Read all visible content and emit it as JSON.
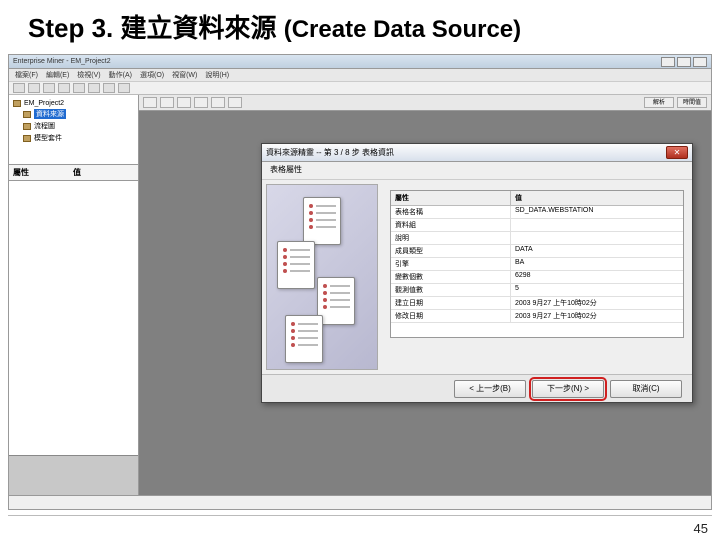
{
  "slide": {
    "step_prefix": "Step 3.",
    "title_cjk": "建立資料來源",
    "title_sub": "(Create Data Source)",
    "page_number": "45"
  },
  "app": {
    "title": "Enterprise Miner - EM_Project2",
    "menus": [
      "檔案(F)",
      "編輯(E)",
      "檢視(V)",
      "動作(A)",
      "選項(O)",
      "視窗(W)",
      "說明(H)"
    ],
    "tree": {
      "root": "EM_Project2",
      "items": [
        "資料來源",
        "流程圖",
        "模型套件"
      ],
      "selected_index": 0
    },
    "props_panel": {
      "col1": "屬性",
      "col2": "值"
    },
    "tab_labels": [
      "解析",
      "時間值"
    ]
  },
  "wizard": {
    "title": "資料來源精靈 -- 第 3 / 8 步 表格資訊",
    "subtitle": "表格屬性",
    "close_label": "✕",
    "table": {
      "col1": "屬性",
      "col2": "值",
      "rows": [
        {
          "k": "表格名稱",
          "v": "SD_DATA.WEBSTATION"
        },
        {
          "k": "資料組",
          "v": ""
        },
        {
          "k": "說明",
          "v": ""
        },
        {
          "k": "成員類型",
          "v": "DATA"
        },
        {
          "k": "引擎",
          "v": "BA"
        },
        {
          "k": "變數個數",
          "v": "6298"
        },
        {
          "k": "觀測值數",
          "v": "5"
        },
        {
          "k": "建立日期",
          "v": "2003 9月27 上午10時02分"
        },
        {
          "k": "修改日期",
          "v": "2003 9月27 上午10時02分"
        }
      ]
    },
    "buttons": {
      "back": "< 上一步(B)",
      "next": "下一步(N) >",
      "cancel": "取消(C)"
    }
  }
}
